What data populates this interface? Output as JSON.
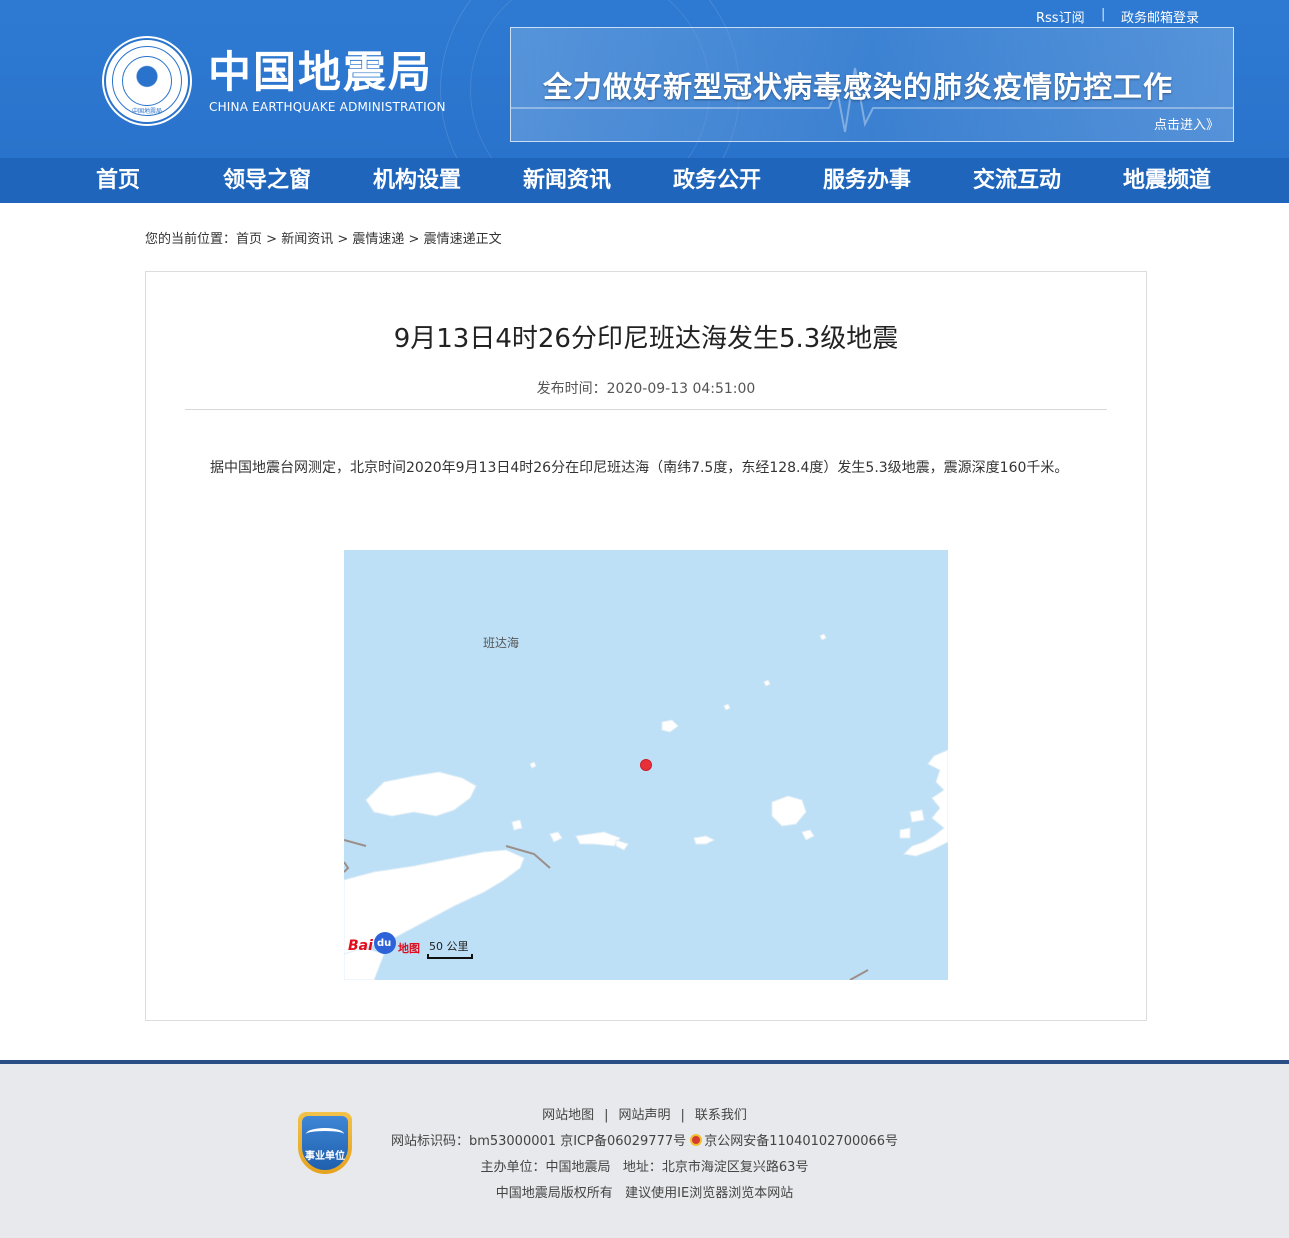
{
  "header": {
    "rss_label": "Rss订阅",
    "separator": "|",
    "mail_label": "政务邮箱登录",
    "logo_cn": "中国地震局",
    "logo_en": "CHINA EARTHQUAKE ADMINISTRATION",
    "emblem_text": "中国地震局",
    "banner_title": "全力做好新型冠状病毒感染的肺炎疫情防控工作",
    "banner_enter": "点击进入》"
  },
  "nav": {
    "items": [
      "首页",
      "领导之窗",
      "机构设置",
      "新闻资讯",
      "政务公开",
      "服务办事",
      "交流互动",
      "地震频道"
    ]
  },
  "breadcrumb": {
    "prefix": "您的当前位置：",
    "items": [
      "首页",
      "新闻资讯",
      "震情速递",
      "震情速递正文"
    ],
    "separator": " > "
  },
  "article": {
    "title": "9月13日4时26分印尼班达海发生5.3级地震",
    "time_label": "发布时间：",
    "time_value": "2020-09-13 04:51:00",
    "body": "据中国地震台网测定，北京时间2020年9月13日4时26分在印尼班达海（南纬7.5度，东经128.4度）发生5.3级地震，震源深度160千米。"
  },
  "map": {
    "sea_label": "班达海",
    "logo_bai": "Bai",
    "logo_du": "du",
    "logo_ditu": "地图",
    "scale_label": "50 公里",
    "sea_color": "#bde0f7",
    "land_color": "#ffffff",
    "epicenter_color": "#e8303a"
  },
  "footer": {
    "links": [
      "网站地图",
      "网站声明",
      "联系我们"
    ],
    "link_sep": "|",
    "badge_text": "事业单位",
    "row1_id": "网站标识码：bm53000001",
    "row1_icp": "京ICP备06029777号",
    "row1_police": "京公网安备11040102700066号",
    "row2": "主办单位：中国地震局   地址：北京市海淀区复兴路63号",
    "row3": "中国地震局版权所有   建议使用IE浏览器浏览本网站"
  }
}
